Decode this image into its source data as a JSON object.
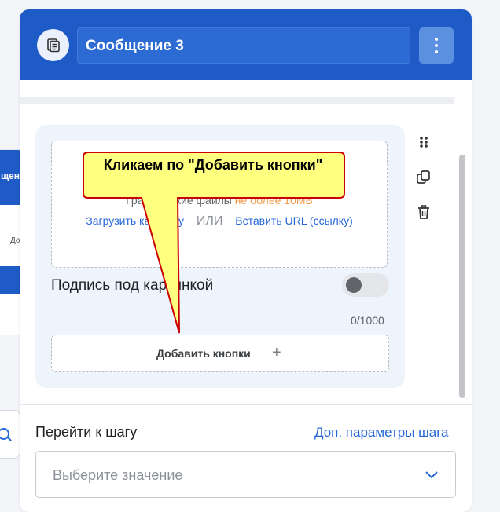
{
  "header": {
    "title": "Сообщение 3",
    "avatar_icon": "document-icon",
    "menu_icon": "kebab-menu-icon",
    "color": "#1e5bc6"
  },
  "background": {
    "partial_title": "щени",
    "partial_small": "До"
  },
  "upload": {
    "hint_prefix": "Графические файлы",
    "hint_limit": "не более 10MB",
    "upload_link": "Загрузить картинку",
    "or_text": "ИЛИ",
    "url_link": "Вставить URL (ссылку)"
  },
  "caption": {
    "label": "Подпись под картинкой",
    "enabled": false,
    "counter": "0/1000"
  },
  "add_buttons": {
    "label": "Добавить кнопки",
    "plus": "+"
  },
  "tools": {
    "drag": "drag-handle-icon",
    "copy": "copy-icon",
    "delete": "trash-icon"
  },
  "step": {
    "label": "Перейти к шагу",
    "params_link": "Доп. параметры шага",
    "select_placeholder": "Выберите значение"
  },
  "annotation": {
    "text": "Кликаем по \"Добавить кнопки\"",
    "fill": "#ffff80",
    "border": "#cc0000"
  }
}
